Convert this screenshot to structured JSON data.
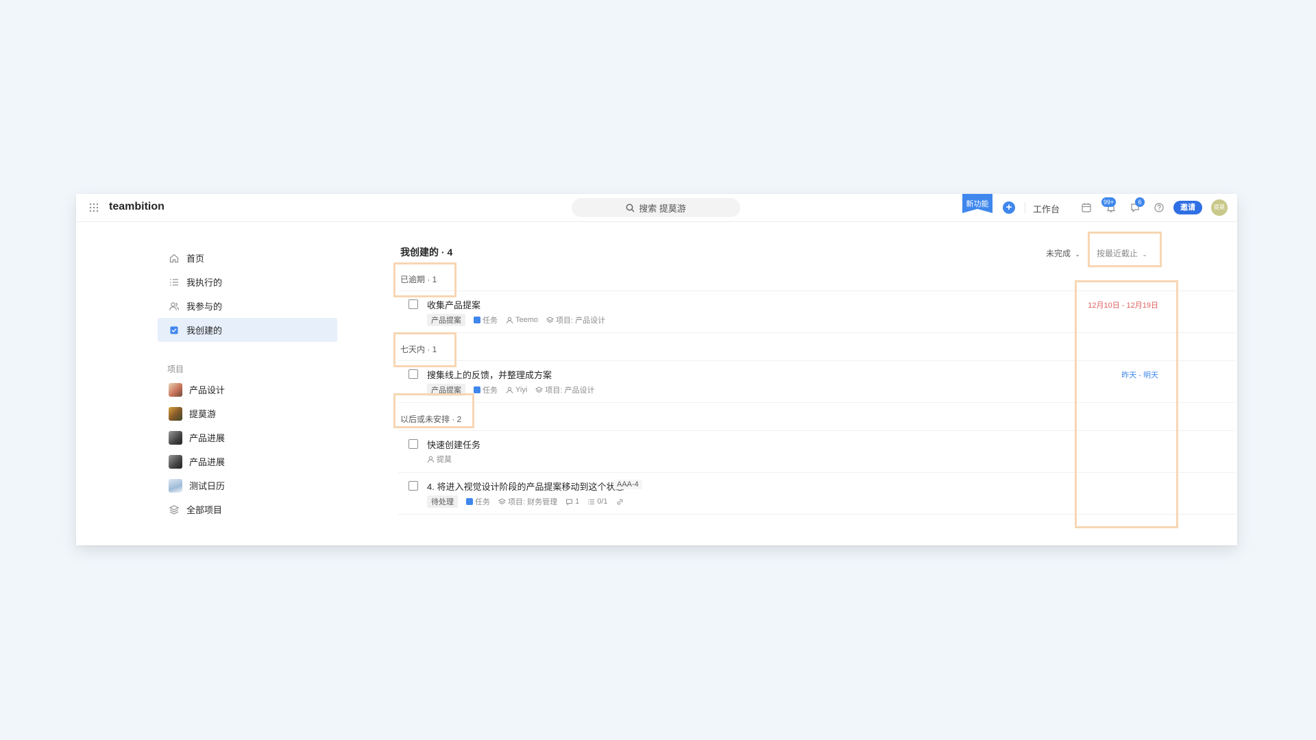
{
  "topbar": {
    "brand": "teambition",
    "search_text": "搜索 提莫游",
    "new_feature": "新功能",
    "workbench": "工作台",
    "notif_badge": "99+",
    "inbox_badge": "6",
    "invite": "邀请",
    "avatar_text": "提莫"
  },
  "sidebar": {
    "items": [
      {
        "label": "首页",
        "icon": "home-icon"
      },
      {
        "label": "我执行的",
        "icon": "list-icon"
      },
      {
        "label": "我参与的",
        "icon": "users-icon"
      },
      {
        "label": "我创建的",
        "icon": "created-icon"
      }
    ],
    "projects_label": "项目",
    "projects": [
      {
        "label": "产品设计"
      },
      {
        "label": "提莫游"
      },
      {
        "label": "产品进展"
      },
      {
        "label": "产品进展"
      },
      {
        "label": "测试日历"
      },
      {
        "label": "全部项目"
      }
    ]
  },
  "main": {
    "title": "我创建的 · 4",
    "filter": "未完成",
    "sort": "按最近截止",
    "groups": [
      {
        "header": "已逾期 · 1",
        "tasks": [
          {
            "title": "收集产品提案",
            "stage": "产品提案",
            "type": "任务",
            "assignee": "Teemo",
            "project": "项目: 产品设计",
            "due": "12月10日 - 12月19日"
          }
        ]
      },
      {
        "header": "七天内 · 1",
        "tasks": [
          {
            "title": "搜集线上的反馈，并整理成方案",
            "stage": "产品提案",
            "type": "任务",
            "assignee": "Yiyi",
            "project": "项目: 产品设计",
            "due": "昨天 - 明天"
          }
        ]
      },
      {
        "header": "以后或未安排 · 2",
        "tasks": [
          {
            "title": "快速创建任务",
            "assignee": "提莫"
          },
          {
            "title": "4. 将进入视觉设计阶段的产品提案移动到这个状态",
            "code": "AAA-4",
            "stage": "待处理",
            "type": "任务",
            "project": "项目: 财务管理",
            "comments": "1",
            "subtasks": "0/1"
          }
        ]
      }
    ]
  },
  "colors": {
    "accent": "#3f87ec",
    "overdue": "#e15e5e",
    "active_bg": "#e6effa",
    "highlight": "#f7d6b3"
  }
}
